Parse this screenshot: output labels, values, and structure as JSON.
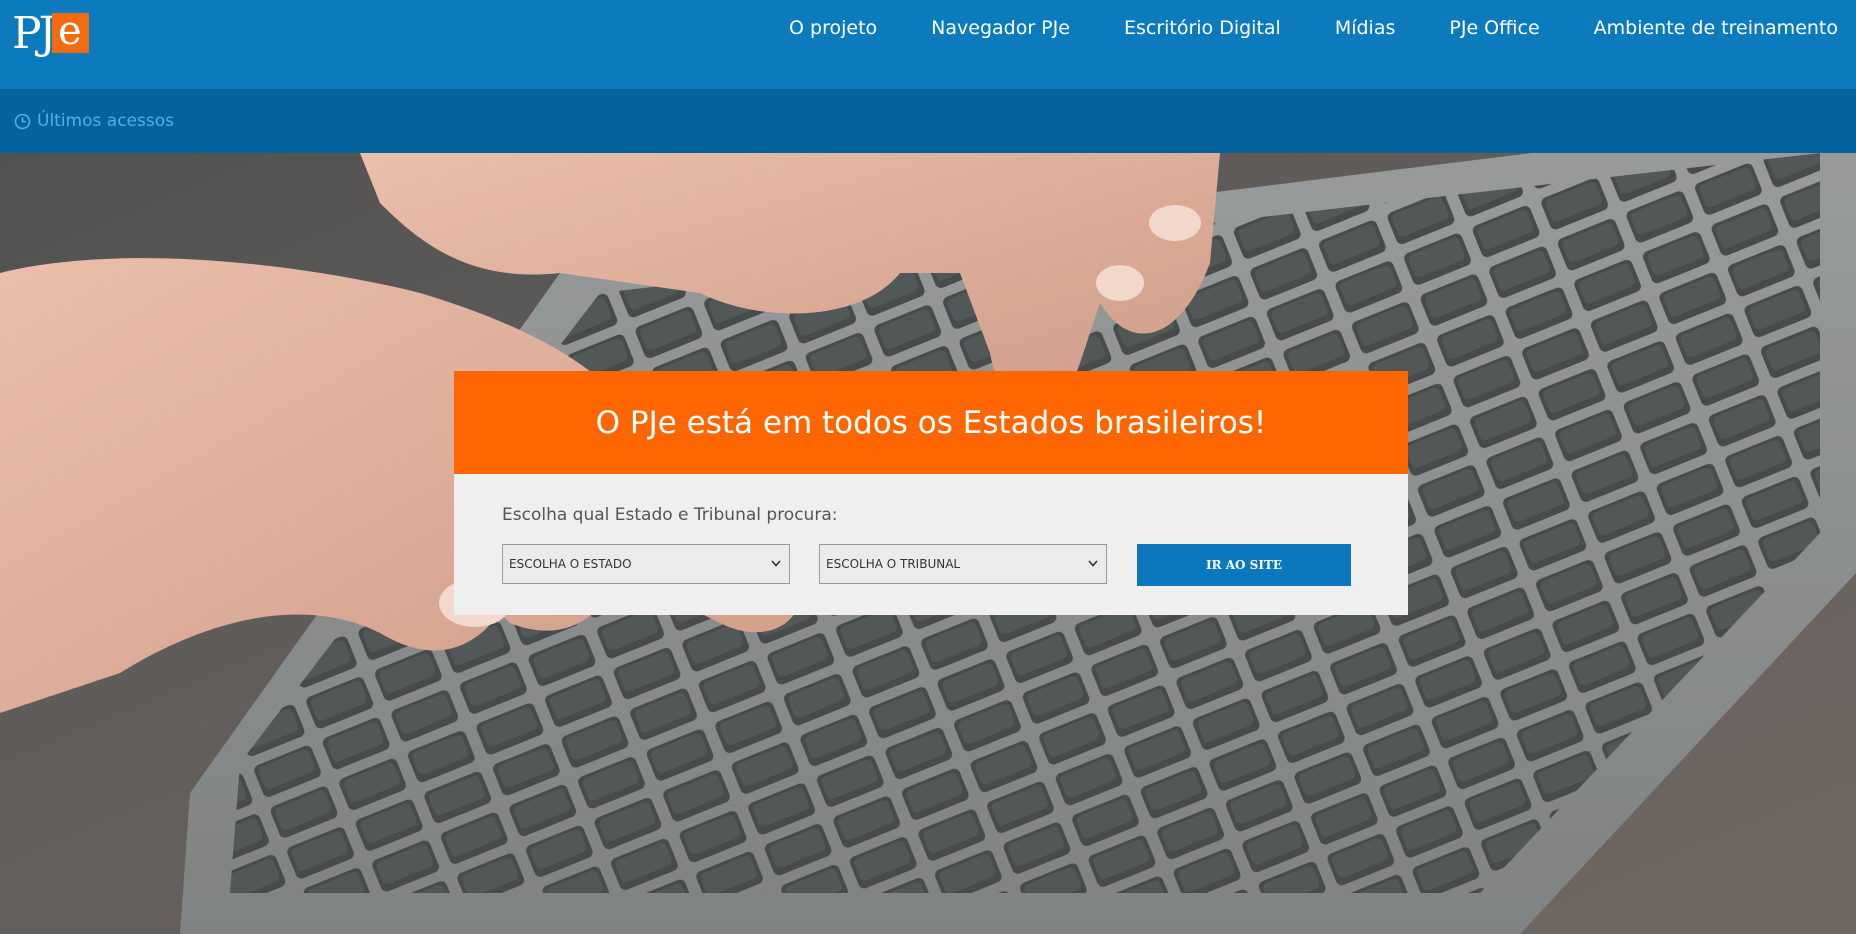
{
  "header": {
    "logo": {
      "text_pj": "PJ",
      "text_e": "e"
    },
    "nav": [
      {
        "label": "O projeto"
      },
      {
        "label": "Navegador PJe"
      },
      {
        "label": "Escritório Digital"
      },
      {
        "label": "Mídias"
      },
      {
        "label": "PJe Office"
      },
      {
        "label": "Ambiente de treinamento"
      }
    ]
  },
  "subbar": {
    "recent_label": "Últimos acessos",
    "icon": "clock-icon"
  },
  "card": {
    "title": "O PJe está em todos os Estados brasileiros!",
    "prompt": "Escolha qual Estado e Tribunal procura:",
    "estado_select": {
      "selected": "ESCOLHA O ESTADO"
    },
    "tribunal_select": {
      "selected": "ESCOLHA O TRIBUNAL"
    },
    "go_button": "IR AO SITE"
  },
  "colors": {
    "header_blue": "#0b7bbe",
    "subbar_blue": "#04639a",
    "accent_orange": "#ff6600",
    "button_blue": "#0b78bd"
  }
}
